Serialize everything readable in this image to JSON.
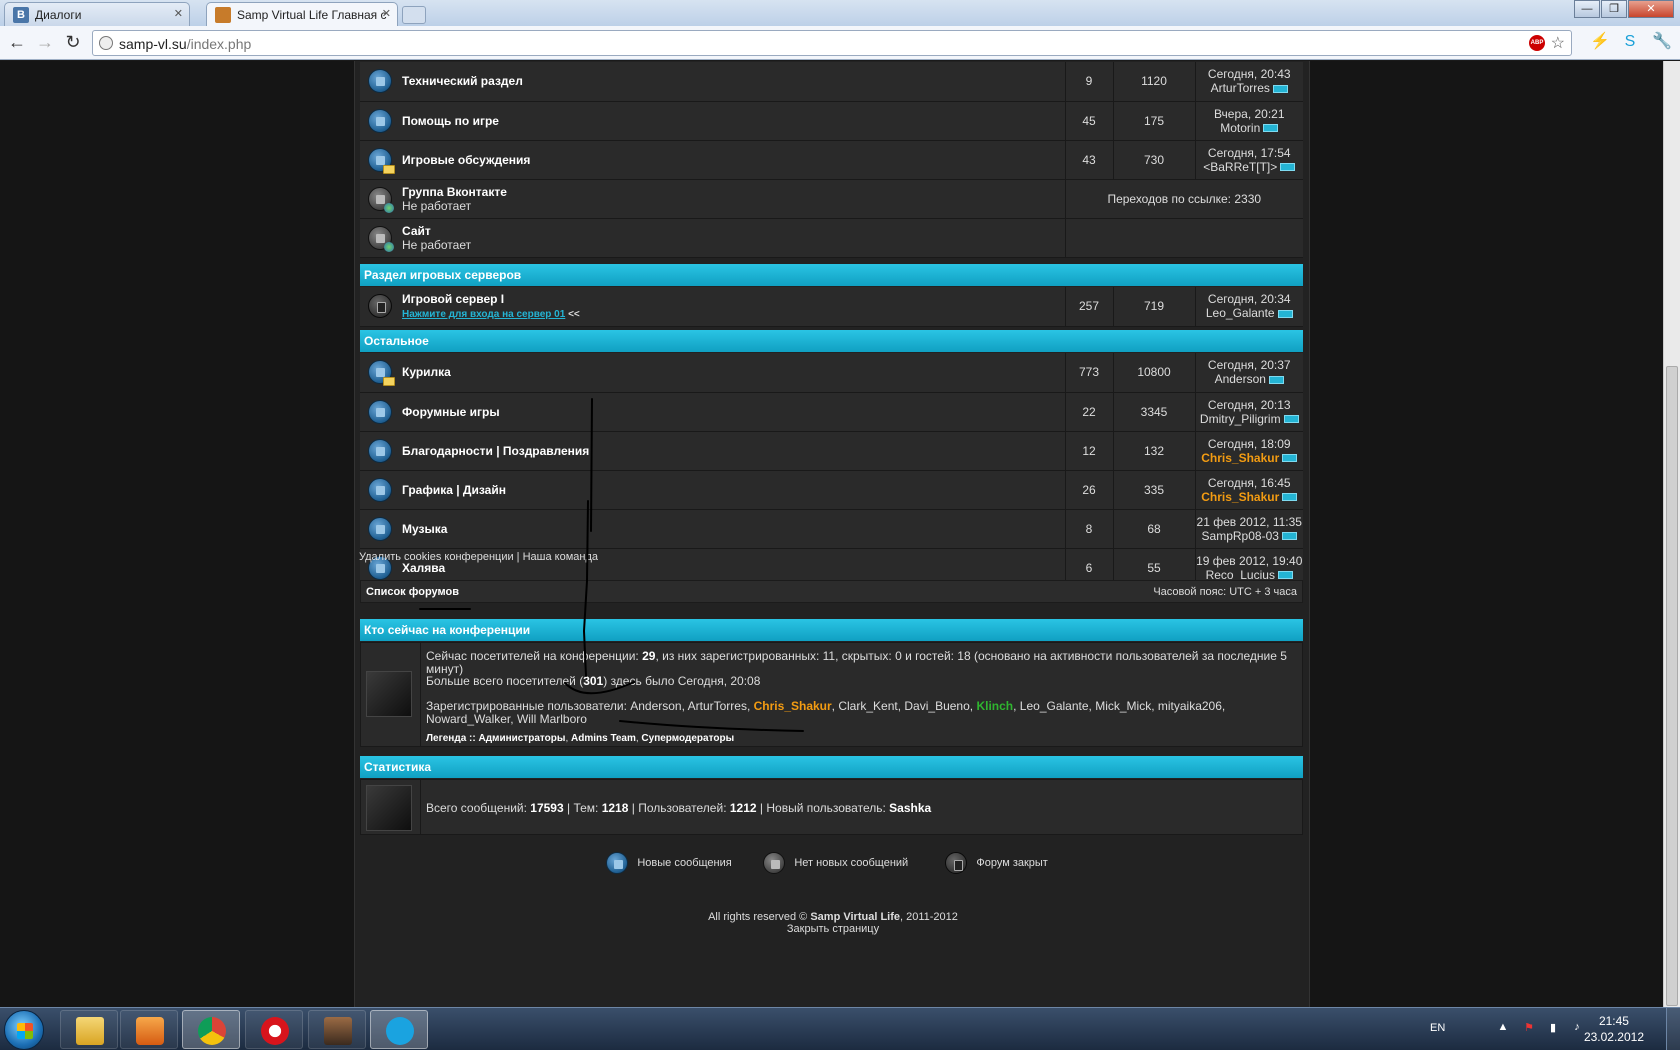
{
  "browser": {
    "tabs": [
      {
        "title": "Диалоги",
        "favicon": "vk-icon"
      },
      {
        "title": "Samp Virtual Life Главная с",
        "favicon": "site-icon"
      }
    ],
    "url_host": "samp-vl.su",
    "url_path": "/index.php",
    "abp_label": "ABP"
  },
  "forums_top": [
    {
      "name": "Технический раздел",
      "sub": "",
      "topics": "9",
      "posts": "1120",
      "last_time": "Сегодня, 20:43",
      "last_user": "ArturTorres",
      "user_style": "",
      "icon": "new"
    },
    {
      "name": "Помощь по игре",
      "sub": "",
      "topics": "45",
      "posts": "175",
      "last_time": "Вчера, 20:21",
      "last_user": "Motorin",
      "user_style": "",
      "icon": "new"
    },
    {
      "name": "Игровые обсуждения",
      "sub": "",
      "topics": "43",
      "posts": "730",
      "last_time": "Сегодня, 17:54",
      "last_user": "<BaRReT[T]>",
      "user_style": "",
      "icon": "folder"
    }
  ],
  "link_forums": [
    {
      "name": "Группа Вконтакте",
      "sub": "Не работает",
      "redirects": "Переходов по ссылке: 2330"
    },
    {
      "name": "Сайт",
      "sub": "Не работает",
      "redirects": ""
    }
  ],
  "categories": {
    "servers": "Раздел игровых серверов",
    "other": "Остальное",
    "online": "Кто сейчас на конференции",
    "stats": "Статистика"
  },
  "server_forum": {
    "name": "Игровой сервер I",
    "link": "Нажмите для входа на сервер 01",
    "link_suffix": " <<",
    "topics": "257",
    "posts": "719",
    "last_time": "Сегодня, 20:34",
    "last_user": "Leo_Galante"
  },
  "forums_other": [
    {
      "name": "Курилка",
      "topics": "773",
      "posts": "10800",
      "last_time": "Сегодня, 20:37",
      "last_user": "Anderson",
      "user_style": "",
      "icon": "folder"
    },
    {
      "name": "Форумные игры",
      "topics": "22",
      "posts": "3345",
      "last_time": "Сегодня, 20:13",
      "last_user": "Dmitry_Piligrim",
      "user_style": "",
      "icon": "new"
    },
    {
      "name": "Благодарности | Поздравления",
      "topics": "12",
      "posts": "132",
      "last_time": "Сегодня, 18:09",
      "last_user": "Chris_Shakur",
      "user_style": "orange",
      "icon": "new"
    },
    {
      "name": "Графика | Дизайн",
      "topics": "26",
      "posts": "335",
      "last_time": "Сегодня, 16:45",
      "last_user": "Chris_Shakur",
      "user_style": "orange",
      "icon": "new"
    },
    {
      "name": "Музыка",
      "topics": "8",
      "posts": "68",
      "last_time": "21 фев 2012, 11:35",
      "last_user": "SampRp08-03",
      "user_style": "",
      "icon": "new"
    },
    {
      "name": "Халява",
      "topics": "6",
      "posts": "55",
      "last_time": "19 фев 2012, 19:40",
      "last_user": "Reco_Lucius",
      "user_style": "",
      "icon": "new"
    }
  ],
  "links": {
    "delete_cookies": "Удалить cookies конференции",
    "sep": " | ",
    "team": "Наша команда"
  },
  "navbar": {
    "left": "Список форумов",
    "right": "Часовой пояс: UTC + 3 часа"
  },
  "online": {
    "line1_pre": "Сейчас посетителей на конференции: ",
    "line1_total": "29",
    "line1_post": ", из них зарегистрированных: 11, скрытых: 0 и гостей: 18 (основано на активности пользователей за последние 5 минут)",
    "line2_pre": "Больше всего посетителей (",
    "line2_max": "301",
    "line2_post": ") здесь было Сегодня, 20:08",
    "users_label": "Зарегистрированные пользователи: ",
    "users": [
      {
        "name": "Anderson",
        "style": ""
      },
      {
        "name": "ArturTorres",
        "style": ""
      },
      {
        "name": "Chris_Shakur",
        "style": "orange"
      },
      {
        "name": "Clark_Kent",
        "style": ""
      },
      {
        "name": "Davi_Bueno",
        "style": ""
      },
      {
        "name": "Klinch",
        "style": "green"
      },
      {
        "name": "Leo_Galante",
        "style": ""
      },
      {
        "name": "Mick_Mick",
        "style": ""
      },
      {
        "name": "mityaika206",
        "style": ""
      },
      {
        "name": "Noward_Walker",
        "style": ""
      },
      {
        "name": "Will Marlboro",
        "style": ""
      }
    ],
    "legend_label": "Легенда :: ",
    "legend": [
      {
        "name": "Администраторы",
        "style": "red"
      },
      {
        "name": "Admins Team",
        "style": "orange"
      },
      {
        "name": "Супермодераторы",
        "style": "green"
      }
    ]
  },
  "stats": {
    "posts_label": "Всего сообщений: ",
    "posts": "17593",
    "topics_label": " | Тем: ",
    "topics": "1218",
    "users_label": " | Пользователей: ",
    "users": "1212",
    "newuser_label": " | Новый пользователь: ",
    "newuser": "Sashka"
  },
  "icon_legend": {
    "new": "Новые сообщения",
    "none": "Нет новых сообщений",
    "locked": "Форум закрыт"
  },
  "footer": {
    "rights_pre": "All rights reserved © ",
    "brand": "Samp Virtual Life",
    "years": ", 2011-2012",
    "close": "Закрыть страницу"
  },
  "taskbar": {
    "lang": "EN",
    "time": "21:45",
    "date": "23.02.2012"
  },
  "colors": {
    "accent": "#1ab4d6",
    "orange": "#f39c12",
    "green": "#2fb52f",
    "red": "#e53030"
  }
}
